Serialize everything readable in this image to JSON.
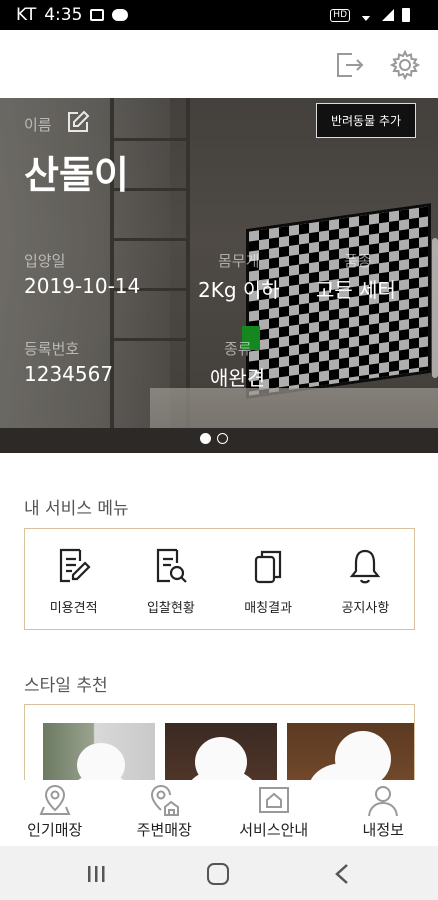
{
  "status_bar": {
    "carrier": "KT",
    "time": "4:35"
  },
  "header": {
    "logout_icon": "logout-icon",
    "settings_icon": "gear-icon"
  },
  "pet": {
    "name_label": "이름",
    "name": "산돌이",
    "add_button": "반려동물 추가",
    "adopt_label": "입양일",
    "adopt_date": "2019-10-14",
    "weight_label": "몸무게",
    "weight": "2Kg 이하",
    "breed_label": "품종",
    "breed": "고든 세터",
    "reg_label": "등록번호",
    "reg_no": "1234567",
    "type_label": "종류",
    "type": "애완견",
    "slide_index": 1,
    "slide_count": 2
  },
  "services": {
    "title": "내 서비스 메뉴",
    "items": [
      {
        "label": "미용견적",
        "icon": "document-edit-icon"
      },
      {
        "label": "입찰현황",
        "icon": "document-search-icon"
      },
      {
        "label": "매칭결과",
        "icon": "copy-pages-icon"
      },
      {
        "label": "공지사항",
        "icon": "bell-icon"
      }
    ]
  },
  "style": {
    "title": "스타일 추천"
  },
  "bottom_nav": [
    {
      "label": "인기매장",
      "icon": "map-pin-icon"
    },
    {
      "label": "주변매장",
      "icon": "nearby-store-icon"
    },
    {
      "label": "서비스안내",
      "icon": "house-window-icon"
    },
    {
      "label": "내정보",
      "icon": "person-icon"
    }
  ],
  "colors": {
    "accent_border": "#d8c29e",
    "button_bg": "#111111"
  }
}
